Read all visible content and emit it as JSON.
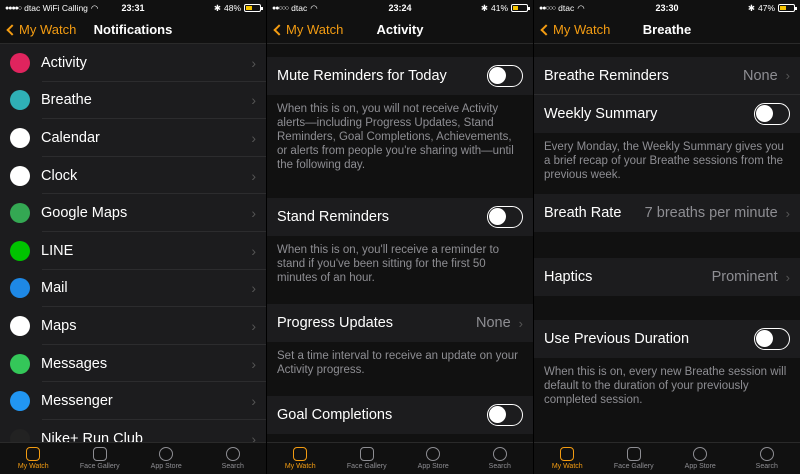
{
  "screens": [
    {
      "status": {
        "carrier": "dtac WiFi Calling",
        "time": "23:31",
        "battery": "48%",
        "battery_fraction": 0.48
      },
      "nav": {
        "back": "My Watch",
        "title": "Notifications"
      },
      "apps": [
        {
          "label": "Activity",
          "icon": "activity-icon",
          "color": "#e0245e"
        },
        {
          "label": "Breathe",
          "icon": "breathe-icon",
          "color": "#2fb0b6"
        },
        {
          "label": "Calendar",
          "icon": "calendar-icon",
          "color": "#ffffff"
        },
        {
          "label": "Clock",
          "icon": "clock-icon",
          "color": "#ffffff"
        },
        {
          "label": "Google Maps",
          "icon": "google-maps-icon",
          "color": "#34a853"
        },
        {
          "label": "LINE",
          "icon": "line-icon",
          "color": "#00c300"
        },
        {
          "label": "Mail",
          "icon": "mail-icon",
          "color": "#1e88e5"
        },
        {
          "label": "Maps",
          "icon": "maps-icon",
          "color": "#ffffff"
        },
        {
          "label": "Messages",
          "icon": "messages-icon",
          "color": "#34c759"
        },
        {
          "label": "Messenger",
          "icon": "messenger-icon",
          "color": "#2196f3"
        },
        {
          "label": "Nike+ Run Club",
          "icon": "nike-icon",
          "color": "#222222"
        }
      ]
    },
    {
      "status": {
        "carrier": "dtac",
        "time": "23:24",
        "battery": "41%",
        "battery_fraction": 0.41
      },
      "nav": {
        "back": "My Watch",
        "title": "Activity"
      },
      "mute": {
        "label": "Mute Reminders for Today",
        "footer": "When this is on, you will not receive Activity alerts—including Progress Updates, Stand Reminders, Goal Completions, Achievements, or alerts from people you're sharing with—until the following day."
      },
      "stand": {
        "label": "Stand Reminders",
        "footer": "When this is on, you'll receive a reminder to stand if you've been sitting for the first 50 minutes of an hour."
      },
      "progress": {
        "label": "Progress Updates",
        "value": "None",
        "footer": "Set a time interval to receive an update on your Activity progress."
      },
      "goal": {
        "label": "Goal Completions"
      }
    },
    {
      "status": {
        "carrier": "dtac",
        "time": "23:30",
        "battery": "47%",
        "battery_fraction": 0.47
      },
      "nav": {
        "back": "My Watch",
        "title": "Breathe"
      },
      "reminders": {
        "label": "Breathe Reminders",
        "value": "None"
      },
      "weekly": {
        "label": "Weekly Summary",
        "footer": "Every Monday, the Weekly Summary gives you a brief recap of your Breathe sessions from the previous week."
      },
      "rate": {
        "label": "Breath Rate",
        "value": "7 breaths per minute"
      },
      "haptics": {
        "label": "Haptics",
        "value": "Prominent"
      },
      "previous": {
        "label": "Use Previous Duration",
        "footer": "When this is on, every new Breathe session will default to the duration of your previously completed session."
      }
    }
  ],
  "tabbar": [
    {
      "label": "My Watch",
      "icon": "watch-icon"
    },
    {
      "label": "Face Gallery",
      "icon": "face-gallery-icon"
    },
    {
      "label": "App Store",
      "icon": "app-store-icon"
    },
    {
      "label": "Search",
      "icon": "search-icon"
    }
  ]
}
